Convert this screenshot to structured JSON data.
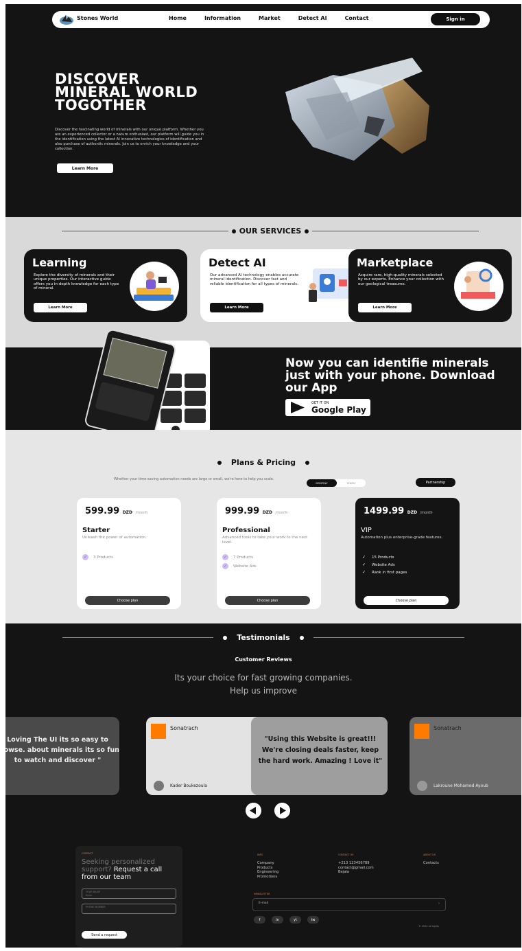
{
  "nav": {
    "brand": "Stones World",
    "links": [
      "Home",
      "Information",
      "Market",
      "Detect AI",
      "Contact"
    ],
    "signin": "Sign in"
  },
  "hero": {
    "title": "DISCOVER MINERAL WORLD TOGOTHER",
    "description": "Discover the fascinating world of minerals with our unique platform. Whether you are an experienced collector or a nature enthusiast, our platform will guide you in the identification using the latest AI innovative technologies of identification and also purchase of authentic minerals. Join us to enrich your knowledge and your collection.",
    "button": "Learn More"
  },
  "services": {
    "heading": "OUR SERVICES",
    "cards": [
      {
        "title": "Learning",
        "description": "Explore the diversity of minerals and their unique properties. Our interactive guide offers you in-depth knowledge for each type of mineral.",
        "button": "Learn More"
      },
      {
        "title": "Detect AI",
        "description": "Our advanced AI technology enables accurate mineral identification. Discover fast and reliable identification for all types of minerals.",
        "button": "Learn More"
      },
      {
        "title": "Marketplace",
        "description": "Acquire rare, high-quality minerals selected by our experts. Enhance your collection with our geological treasures.",
        "button": "Learn More"
      }
    ]
  },
  "app_banner": {
    "title": "Now you can identifie minerals just with your phone. Download our App",
    "store_small": "GET IT ON",
    "store_name": "Google Play"
  },
  "pricing": {
    "heading": "Plans & Pricing",
    "subtitle": "Whether your time-saving automation needs are large or small, we're here to help you scale.",
    "toggle_on": "MONTHLY",
    "toggle_off": "YEARLY",
    "partnership": "Partnership",
    "plans": [
      {
        "price": "599.99",
        "currency": "DZD",
        "period": "/month",
        "name": "Starter",
        "description": "Unleash the power of automation.",
        "features": [
          "3 Products"
        ],
        "button": "Choose plan"
      },
      {
        "price": "999.99",
        "currency": "DZD",
        "period": "/month",
        "name": "Professional",
        "description": "Advanced tools to take your work to the next level.",
        "features": [
          "7 Products",
          "Website Ads"
        ],
        "button": "Choose plan"
      },
      {
        "price": "1499.99",
        "currency": "DZD",
        "period": "/month",
        "name": "VIP",
        "description": "Automation plus enterprise-grade features.",
        "features": [
          "15 Products",
          "Website Ads",
          "Rank in first pages"
        ],
        "button": "Choose plan"
      }
    ]
  },
  "testimonials": {
    "heading": "Testimonials",
    "subheading": "Customer Reviews",
    "tagline_1": "Its your choice for fast growing companies.",
    "tagline_2": "Help us improve",
    "left_quote": "Loving The UI its so easy to browse. about minerals its so fun to watch and discover \"",
    "middle": {
      "company": "Sonatrach",
      "author": "Kader Boukezoula",
      "quote": "\"Using this Website is great!!! We're closing deals faster, keep the hard work. Amazing ! Love it\""
    },
    "right": {
      "company": "Sonatrach",
      "author": "Lakroune Mohamed Ayoub"
    }
  },
  "footer": {
    "contact_small": "CONTACT",
    "contact_title_muted": "Seeking personalized support?",
    "contact_title_bold": "Request a call from our team",
    "name_label": "YOUR NAME",
    "name_value": "Enter",
    "phone_label": "PHONE NUMBER",
    "send": "Send a request",
    "col1_head": "INFO",
    "col1_items": [
      "Company",
      "Products",
      "Engineering",
      "Promotions"
    ],
    "col2_head": "CONTACT US",
    "col2_items": [
      "+213 123456789",
      "contact@gmail.com",
      "Bejaia"
    ],
    "col3_head": "ABOUT US",
    "col3_items": [
      "Contacts"
    ],
    "newsletter_head": "NEWSLETTER",
    "email_placeholder": "E-mail",
    "social": [
      "f",
      "in",
      "yt",
      "tw"
    ],
    "copyright": "© 2024 all rights"
  }
}
